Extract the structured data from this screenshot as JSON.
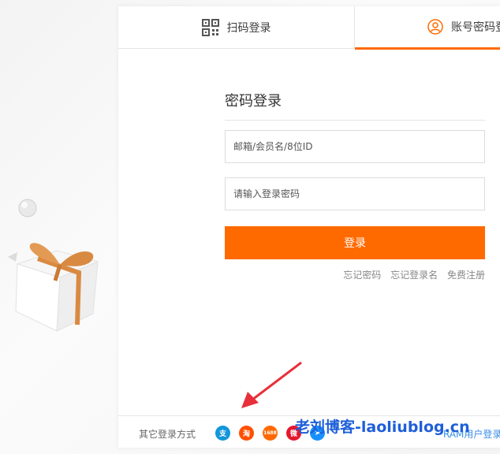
{
  "tabs": {
    "qr_label": "扫码登录",
    "account_label": "账号密码登录"
  },
  "form": {
    "title": "密码登录",
    "username_placeholder": "邮箱/会员名/8位ID",
    "password_placeholder": "请输入登录密码",
    "login_button": "登录",
    "links": {
      "forgot_password": "忘记密码",
      "forgot_username": "忘记登录名",
      "register": "免费注册"
    }
  },
  "bottom": {
    "other_login_label": "其它登录方式",
    "social_icons": [
      {
        "name": "alipay-icon",
        "glyph": "支"
      },
      {
        "name": "taobao-icon",
        "glyph": "淘"
      },
      {
        "name": "1688-icon",
        "glyph": "1688"
      },
      {
        "name": "weibo-icon",
        "glyph": "微"
      },
      {
        "name": "dingtalk-icon",
        "glyph": "➤"
      }
    ],
    "ram_link": "RAM用户登录"
  },
  "watermark": "老刘博客-laoliublog.cn",
  "colors": {
    "accent": "#ff6a00",
    "link": "#3a8ee6",
    "watermark": "#1e5fd9",
    "arrow": "#e8303a"
  }
}
